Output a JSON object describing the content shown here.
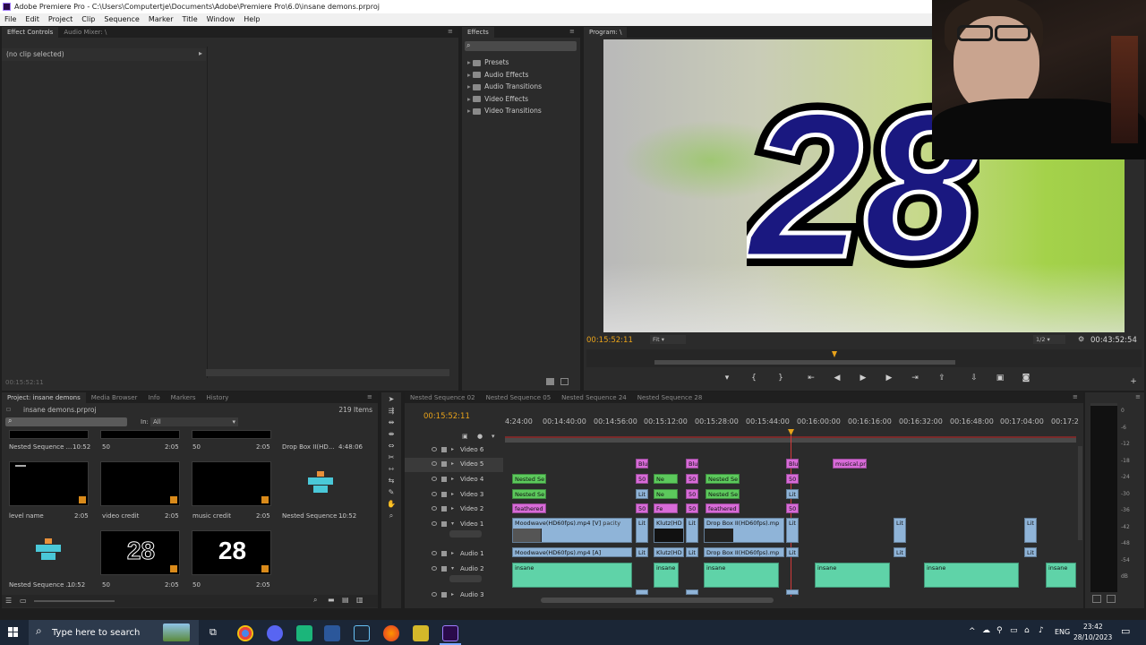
{
  "window": {
    "title": "Adobe Premiere Pro - C:\\Users\\Computertje\\Documents\\Adobe\\Premiere Pro\\6.0\\insane demons.prproj"
  },
  "menu": [
    "File",
    "Edit",
    "Project",
    "Clip",
    "Sequence",
    "Marker",
    "Title",
    "Window",
    "Help"
  ],
  "effect_controls": {
    "tabs": [
      "Effect Controls",
      "Audio Mixer: \\"
    ],
    "no_clip": "(no clip selected)",
    "timecode": "00:15:52:11"
  },
  "effects": {
    "tab": "Effects",
    "items": [
      "Presets",
      "Audio Effects",
      "Audio Transitions",
      "Video Effects",
      "Video Transitions"
    ]
  },
  "program": {
    "tab": "Program: \\",
    "overlay_number": "28",
    "timecode_current": "00:15:52:11",
    "fit": "Fit",
    "resolution": "1/2",
    "timecode_total": "00:43:52:54"
  },
  "project": {
    "tabs": [
      "Project: insane demons",
      "Media Browser",
      "Info",
      "Markers",
      "History"
    ],
    "file": "insane demons.prproj",
    "count": "219 Items",
    "in_label": "In:",
    "in_value": "All",
    "top_row": [
      {
        "name": "Nested Sequence ...",
        "dur": "10:52"
      },
      {
        "name": "50",
        "dur": "2:05"
      },
      {
        "name": "50",
        "dur": "2:05"
      },
      {
        "name": "Drop Box II(HD...",
        "dur": "4:48:06"
      }
    ],
    "items": [
      {
        "name": "level name",
        "dur": "2:05"
      },
      {
        "name": "video credit",
        "dur": "2:05"
      },
      {
        "name": "music credit",
        "dur": "2:05"
      },
      {
        "name": "Nested Sequence ...",
        "dur": "10:52"
      },
      {
        "name": "Nested Sequence ...",
        "dur": "10:52"
      },
      {
        "name": "50",
        "dur": "2:05"
      },
      {
        "name": "50",
        "dur": "2:05"
      }
    ],
    "thumb_text_28": "28"
  },
  "timeline": {
    "tabs": [
      "Nested Sequence 02",
      "Nested Sequence 05",
      "Nested Sequence 24",
      "Nested Sequence 28"
    ],
    "timecode": "00:15:52:11",
    "ruler": [
      "4:24:00",
      "00:14:40:00",
      "00:14:56:00",
      "00:15:12:00",
      "00:15:28:00",
      "00:15:44:00",
      "00:16:00:00",
      "00:16:16:00",
      "00:16:32:00",
      "00:16:48:00",
      "00:17:04:00",
      "00:17:2"
    ],
    "tracks": [
      "Video 6",
      "Video 5",
      "Video 4",
      "Video 3",
      "Video 2",
      "Video 1",
      "Audio 1",
      "Audio 2",
      "Audio 3"
    ],
    "clips": {
      "nested": "Nested Se",
      "feathered": "feathered",
      "blur": "Blu",
      "fifty": "50",
      "musical": "musical.pr",
      "moodwave_v": "Moodwave(HD60fps).mp4 [V]",
      "opacity": "pacity",
      "klutz": "Klutz(HD",
      "dropbox": "Drop Box II(HD60fps).mp",
      "lit": "Lit",
      "moodwave_a": "Moodwave(HD60fps).mp4 [A]",
      "dropbox_a": "Drop Box II(HD60fps).mp",
      "insane": "insane",
      "ne": "Ne",
      "fe": "Fe"
    }
  },
  "meter": [
    "0",
    "-6",
    "-12",
    "-18",
    "-24",
    "-30",
    "-36",
    "-42",
    "-48",
    "-54",
    "dB"
  ],
  "taskbar": {
    "search": "Type here to search",
    "lang": "ENG",
    "time": "23:42",
    "date": "28/10/2023"
  }
}
